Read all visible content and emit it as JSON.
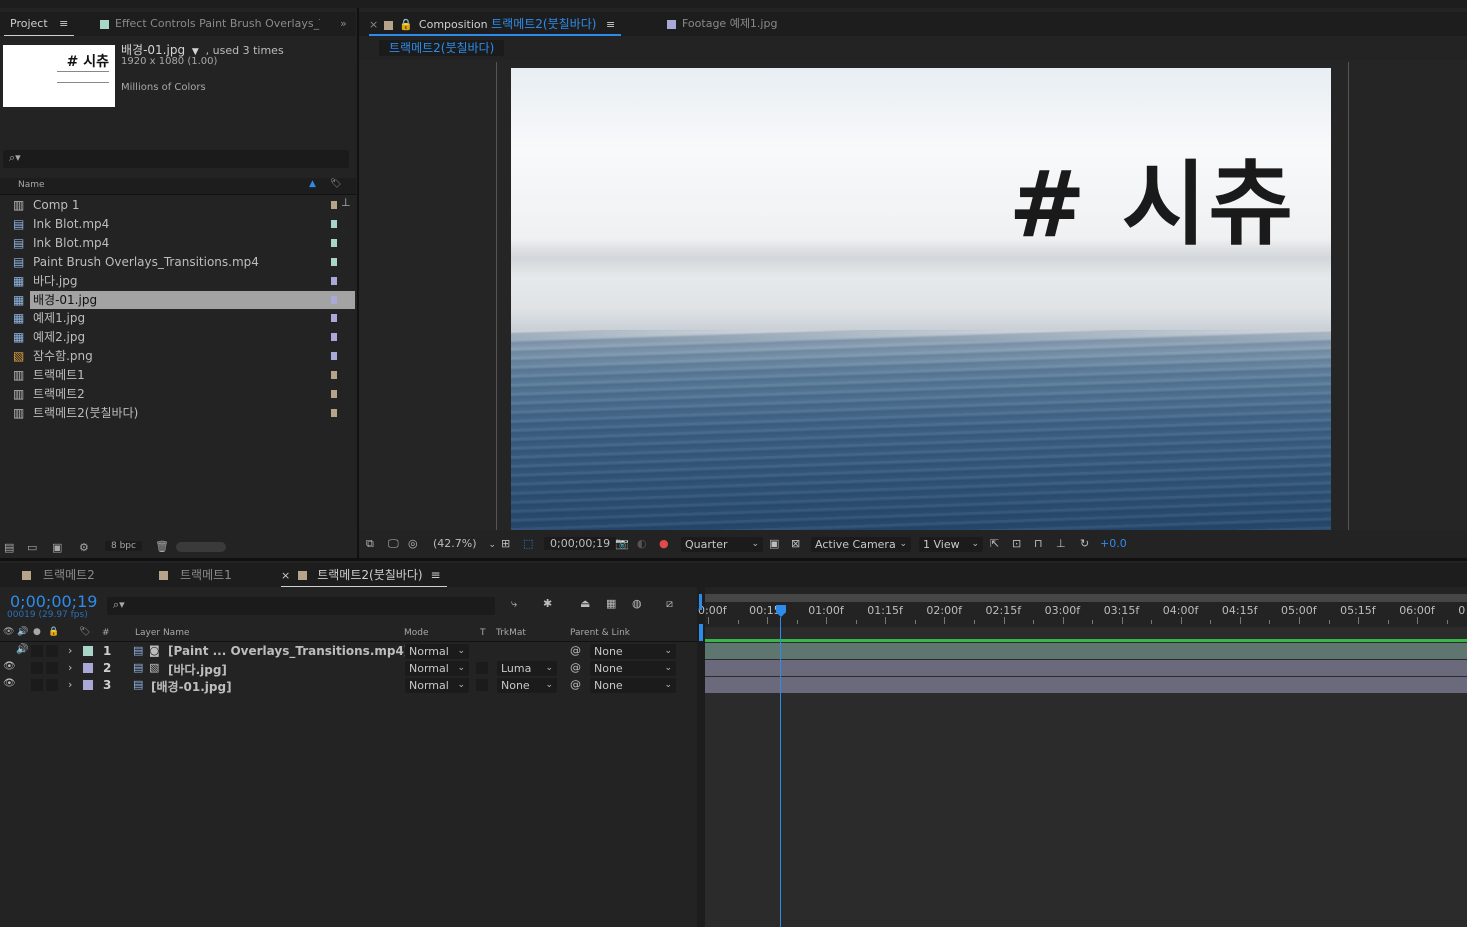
{
  "project": {
    "tab_label": "Project",
    "effect_controls_tab": "Effect Controls Paint Brush Overlays_Tr",
    "thumb_title": "# 시츄",
    "selected_name": "배경-01.jpg",
    "used_text": ", used 3 times",
    "dimensions": "1920 x 1080 (1.00)",
    "colors": "Millions of Colors",
    "search_placeholder": "",
    "col_name": "Name",
    "items": [
      {
        "name": "Comp 1",
        "type": "comp",
        "label": "#b5a48a"
      },
      {
        "name": "Ink Blot.mp4",
        "type": "video",
        "label": "#a9d4c8"
      },
      {
        "name": "Ink Blot.mp4",
        "type": "video",
        "label": "#a9d4c8"
      },
      {
        "name": "Paint Brush Overlays_Transitions.mp4",
        "type": "video",
        "label": "#a9d4c8"
      },
      {
        "name": "바다.jpg",
        "type": "image",
        "label": "#a9a8d6"
      },
      {
        "name": "배경-01.jpg",
        "type": "image",
        "label": "#a9a8d6",
        "selected": true
      },
      {
        "name": "예제1.jpg",
        "type": "image",
        "label": "#a9a8d6"
      },
      {
        "name": "예제2.jpg",
        "type": "image",
        "label": "#a9a8d6"
      },
      {
        "name": "잠수함.png",
        "type": "png",
        "label": "#a9a8d6"
      },
      {
        "name": "트랙메트1",
        "type": "comp",
        "label": "#b5a48a"
      },
      {
        "name": "트랙메트2",
        "type": "comp",
        "label": "#b5a48a"
      },
      {
        "name": "트랙메트2(붓칠바다)",
        "type": "comp",
        "label": "#b5a48a"
      }
    ],
    "bpc": "8 bpc"
  },
  "composition": {
    "tab_prefix": "Composition",
    "tab_name": "트랙메트2(붓칠바다)",
    "footage_tab": "Footage 예제1.jpg",
    "breadcrumb": "트랙메트2(붓칠바다)",
    "overlay_title": "# 시츄",
    "zoom": "(42.7%)",
    "timecode": "0;00;00;19",
    "resolution": "Quarter",
    "camera": "Active Camera",
    "views": "1 View",
    "exposure": "+0.0"
  },
  "timeline": {
    "tabs": [
      "트랙메트2",
      "트랙메트1",
      "트랙메트2(붓칠바다)"
    ],
    "timecode": "0;00;00;19",
    "frames": "00019 (29.97 fps)",
    "headers": {
      "num": "#",
      "layer_name": "Layer Name",
      "mode": "Mode",
      "t": "T",
      "trkmat": "TrkMat",
      "parent": "Parent & Link"
    },
    "ruler": [
      "0:00f",
      "00:15f",
      "01:00f",
      "01:15f",
      "02:00f",
      "02:15f",
      "03:00f",
      "03:15f",
      "04:00f",
      "04:15f",
      "05:00f",
      "05:15f",
      "06:00f",
      "0"
    ],
    "playhead_frame": 19,
    "layers": [
      {
        "num": "1",
        "name": "[Paint ... Overlays_Transitions.mp4]",
        "mode": "Normal",
        "trkmat": "",
        "parent": "None",
        "label": "#a9d4c8",
        "audio": true
      },
      {
        "num": "2",
        "name": "[바다.jpg]",
        "mode": "Normal",
        "trkmat": "Luma",
        "parent": "None",
        "label": "#a9a8d6",
        "audio": false
      },
      {
        "num": "3",
        "name": "[배경-01.jpg]",
        "mode": "Normal",
        "trkmat": "None",
        "parent": "None",
        "label": "#a9a8d6",
        "audio": false
      }
    ]
  },
  "colors": {
    "accent": "#2d8ceb",
    "selection": "#a3a3a3"
  }
}
